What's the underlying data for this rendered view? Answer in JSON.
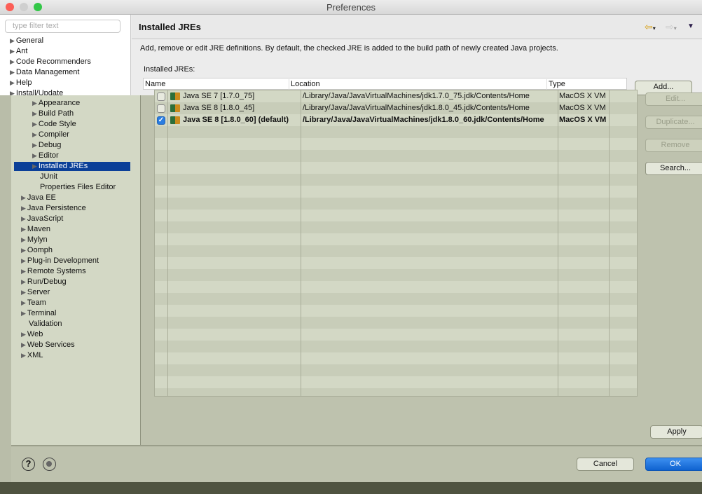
{
  "window": {
    "title": "Preferences"
  },
  "filter": {
    "placeholder": "type filter text"
  },
  "tree_top": [
    "General",
    "Ant",
    "Code Recommenders",
    "Data Management",
    "Help",
    "Install/Update"
  ],
  "tree_java_children": [
    "Appearance",
    "Build Path",
    "Code Style",
    "Compiler",
    "Debug",
    "Editor",
    "Installed JREs",
    "JUnit",
    "Properties Files Editor"
  ],
  "tree_java_selected": "Installed JREs",
  "tree_bottom": [
    {
      "label": "Java EE",
      "arrow": true
    },
    {
      "label": "Java Persistence",
      "arrow": true
    },
    {
      "label": "JavaScript",
      "arrow": true
    },
    {
      "label": "Maven",
      "arrow": true
    },
    {
      "label": "Mylyn",
      "arrow": true
    },
    {
      "label": "Oomph",
      "arrow": true
    },
    {
      "label": "Plug-in Development",
      "arrow": true
    },
    {
      "label": "Remote Systems",
      "arrow": true
    },
    {
      "label": "Run/Debug",
      "arrow": true
    },
    {
      "label": "Server",
      "arrow": true
    },
    {
      "label": "Team",
      "arrow": true
    },
    {
      "label": "Terminal",
      "arrow": true
    },
    {
      "label": "Validation",
      "arrow": false
    },
    {
      "label": "Web",
      "arrow": true
    },
    {
      "label": "Web Services",
      "arrow": true
    },
    {
      "label": "XML",
      "arrow": true
    }
  ],
  "page": {
    "title": "Installed JREs",
    "description": "Add, remove or edit JRE definitions. By default, the checked JRE is added to the build path of newly created Java projects.",
    "table_label": "Installed JREs:"
  },
  "table": {
    "columns": [
      "Name",
      "Location",
      "Type"
    ],
    "rows": [
      {
        "checked": false,
        "bold": false,
        "name": "Java SE 7 [1.7.0_75]",
        "location": "/Library/Java/JavaVirtualMachines/jdk1.7.0_75.jdk/Contents/Home",
        "type": "MacOS X VM"
      },
      {
        "checked": false,
        "bold": false,
        "name": "Java SE 8 [1.8.0_45]",
        "location": "/Library/Java/JavaVirtualMachines/jdk1.8.0_45.jdk/Contents/Home",
        "type": "MacOS X VM"
      },
      {
        "checked": true,
        "bold": true,
        "name": "Java SE 8 [1.8.0_60] (default)",
        "location": "/Library/Java/JavaVirtualMachines/jdk1.8.0_60.jdk/Contents/Home",
        "type": "MacOS X VM"
      }
    ]
  },
  "buttons": {
    "add": "Add...",
    "edit": "Edit...",
    "duplicate": "Duplicate...",
    "remove": "Remove",
    "search": "Search...",
    "apply": "Apply",
    "cancel": "Cancel",
    "ok": "OK"
  },
  "colors": {
    "accent": "#1f6fd6",
    "selection": "#0b3f98"
  }
}
